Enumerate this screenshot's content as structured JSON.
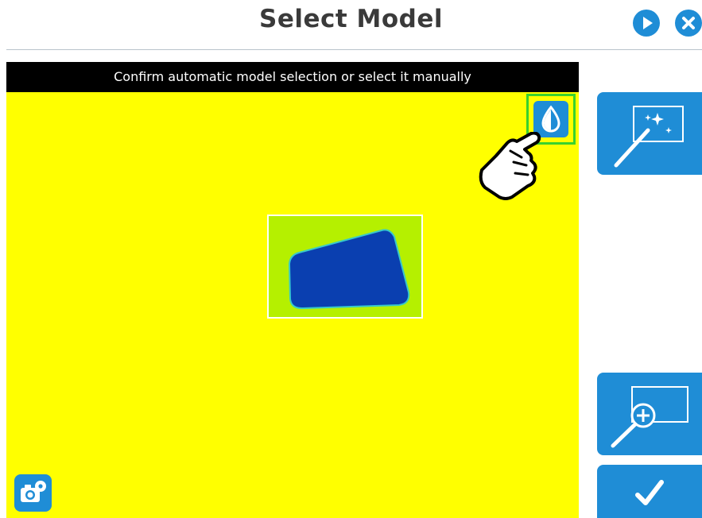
{
  "header": {
    "title": "Select Model",
    "next_icon": "play-icon",
    "close_icon": "close-icon"
  },
  "camera": {
    "banner_text": "Confirm automatic model selection or select it manually",
    "background_color": "#ffff00",
    "selection_background": "#b5f000",
    "model_color": "#0a3fb0",
    "color_picker_icon": "droplet-icon",
    "settings_icon": "camera-settings-icon",
    "pointer_icon": "pointing-hand-icon"
  },
  "side_panel": {
    "auto_select_icon": "magic-wand-icon",
    "zoom_icon": "zoom-in-icon",
    "confirm_icon": "checkmark-icon"
  },
  "colors": {
    "accent": "#1f8dd6",
    "highlight": "#39d12e"
  }
}
